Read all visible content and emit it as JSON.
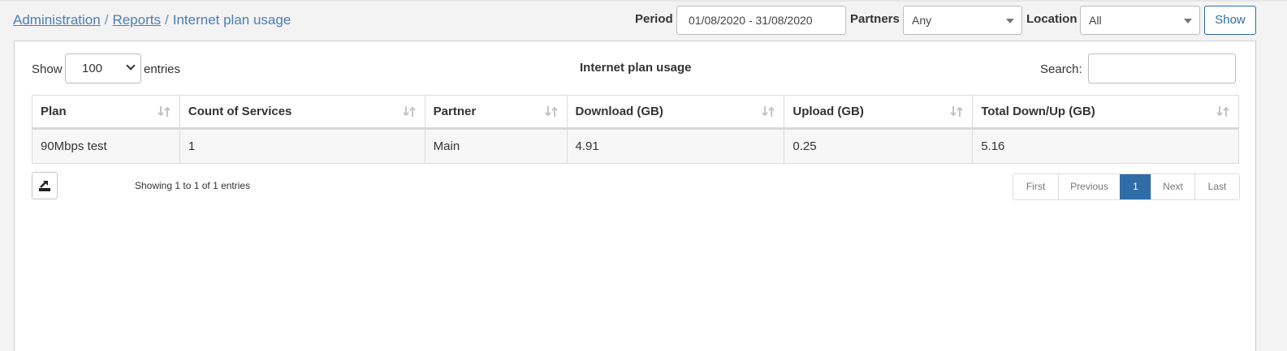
{
  "breadcrumb": {
    "items": [
      "Administration",
      "Reports"
    ],
    "separator": "/",
    "current": "Internet plan usage"
  },
  "filters": {
    "period_label": "Period",
    "period_value": "01/08/2020 - 31/08/2020",
    "partners_label": "Partners",
    "partners_value": "Any",
    "location_label": "Location",
    "location_value": "All",
    "show_button": "Show"
  },
  "table_controls": {
    "length_prefix": "Show",
    "length_value": "100",
    "length_suffix": "entries",
    "title": "Internet plan usage",
    "search_label": "Search:",
    "search_value": ""
  },
  "table": {
    "columns": [
      "Plan",
      "Count of Services",
      "Partner",
      "Download (GB)",
      "Upload (GB)",
      "Total Down/Up (GB)"
    ],
    "rows": [
      [
        "90Mbps test",
        "1",
        "Main",
        "4.91",
        "0.25",
        "5.16"
      ]
    ]
  },
  "footer": {
    "info": "Showing 1 to 1 of 1 entries",
    "export_icon": "export-icon",
    "pagination": [
      "First",
      "Previous",
      "1",
      "Next",
      "Last"
    ],
    "active_page": "1"
  },
  "colors": {
    "accent": "#2f6da8",
    "link": "#4a7fb5"
  }
}
